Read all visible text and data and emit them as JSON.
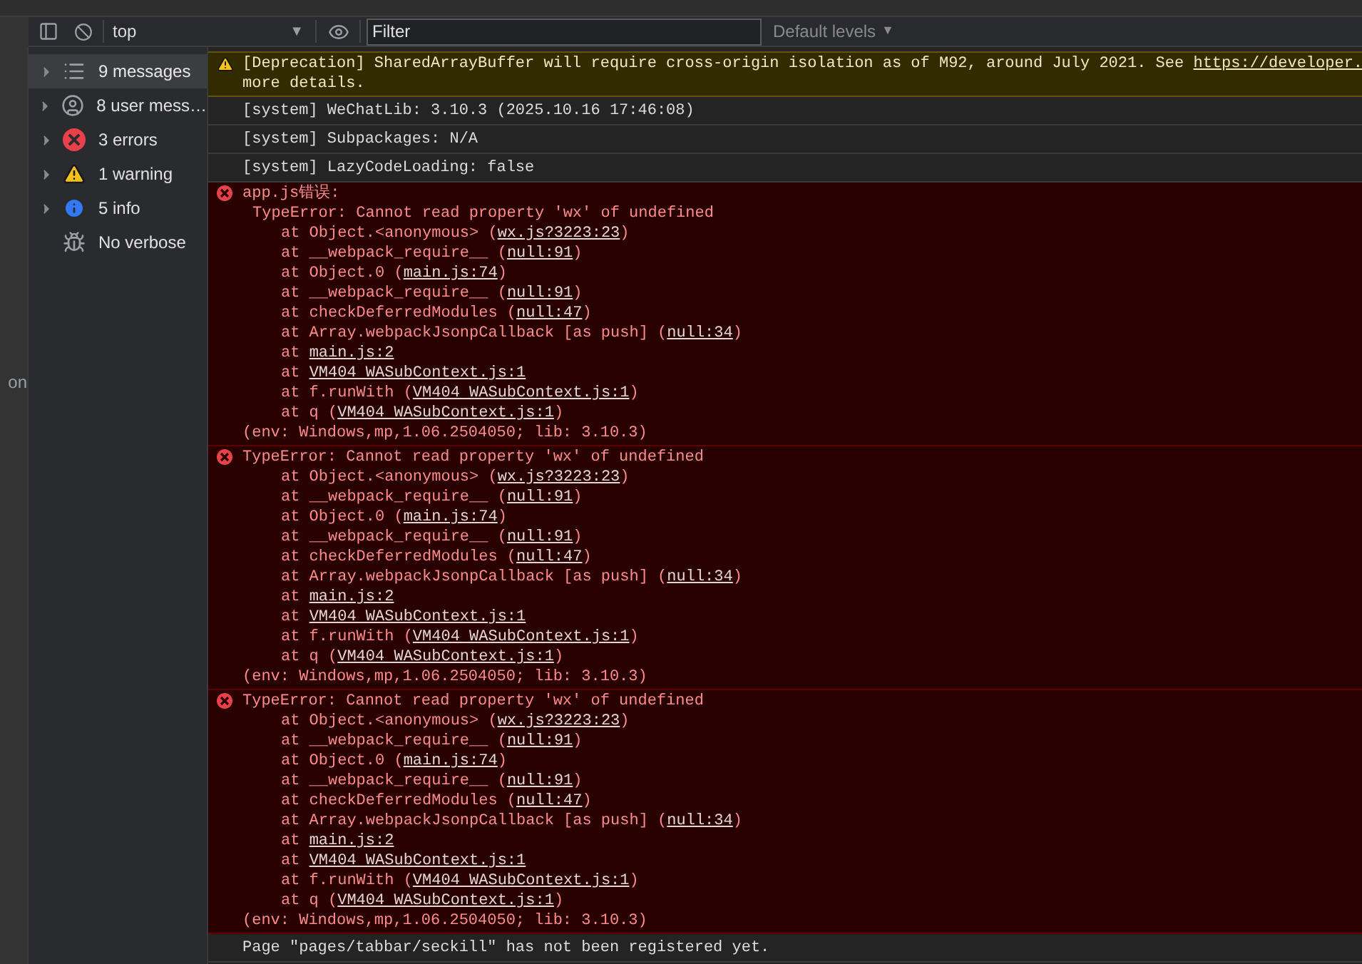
{
  "toolbar": {
    "context": "top",
    "context_caret": "▼",
    "filter": {
      "placeholder": "Filter"
    },
    "levels": "Default levels",
    "levels_caret": "▼"
  },
  "edge_text": "on",
  "sidebar": {
    "items": [
      {
        "kind": "list",
        "label": "9 messages",
        "selected": true,
        "expanded": false
      },
      {
        "kind": "user",
        "label": "8 user mess…",
        "selected": false,
        "expanded": false
      },
      {
        "kind": "error",
        "label": "3 errors",
        "selected": false,
        "expanded": false
      },
      {
        "kind": "warning",
        "label": "1 warning",
        "selected": false,
        "expanded": false
      },
      {
        "kind": "info",
        "label": "5 info",
        "selected": false,
        "expanded": false
      },
      {
        "kind": "verbose",
        "label": "No verbose",
        "selected": false
      }
    ]
  },
  "messages": [
    {
      "kind": "warning",
      "lines": [
        {
          "text": "[Deprecation] SharedArrayBuffer will require cross-origin isolation as of M92, around July 2021. See ",
          "link": "https://developer."
        },
        {
          "text": "more details."
        }
      ]
    },
    {
      "kind": "system",
      "text": "[system] WeChatLib: 3.10.3 (2025.10.16 17:46:08)"
    },
    {
      "kind": "system",
      "text": "[system] Subpackages: N/A"
    },
    {
      "kind": "system",
      "text": "[system] LazyCodeLoading: false"
    },
    {
      "kind": "error",
      "title": "app.js错误:",
      "error": "TypeError: Cannot read property 'wx' of undefined",
      "frames": [
        {
          "pre": "at Object.<anonymous> (",
          "link": "wx.js?3223:23",
          "post": ")"
        },
        {
          "pre": "at __webpack_require__ (",
          "link": "null:91",
          "post": ")"
        },
        {
          "pre": "at Object.0 (",
          "link": "main.js:74",
          "post": ")"
        },
        {
          "pre": "at __webpack_require__ (",
          "link": "null:91",
          "post": ")"
        },
        {
          "pre": "at checkDeferredModules (",
          "link": "null:47",
          "post": ")"
        },
        {
          "pre": "at Array.webpackJsonpCallback [as push] (",
          "link": "null:34",
          "post": ")"
        },
        {
          "pre": "at ",
          "link": "main.js:2"
        },
        {
          "pre": "at ",
          "link": "VM404 WASubContext.js:1"
        },
        {
          "pre": "at f.runWith (",
          "link": "VM404 WASubContext.js:1",
          "post": ")"
        },
        {
          "pre": "at q (",
          "link": "VM404 WASubContext.js:1",
          "post": ")"
        }
      ],
      "env": "(env: Windows,mp,1.06.2504050; lib: 3.10.3)"
    },
    {
      "kind": "error",
      "error": "TypeError: Cannot read property 'wx' of undefined",
      "frames": [
        {
          "pre": "at Object.<anonymous> (",
          "link": "wx.js?3223:23",
          "post": ")"
        },
        {
          "pre": "at __webpack_require__ (",
          "link": "null:91",
          "post": ")"
        },
        {
          "pre": "at Object.0 (",
          "link": "main.js:74",
          "post": ")"
        },
        {
          "pre": "at __webpack_require__ (",
          "link": "null:91",
          "post": ")"
        },
        {
          "pre": "at checkDeferredModules (",
          "link": "null:47",
          "post": ")"
        },
        {
          "pre": "at Array.webpackJsonpCallback [as push] (",
          "link": "null:34",
          "post": ")"
        },
        {
          "pre": "at ",
          "link": "main.js:2"
        },
        {
          "pre": "at ",
          "link": "VM404 WASubContext.js:1"
        },
        {
          "pre": "at f.runWith (",
          "link": "VM404 WASubContext.js:1",
          "post": ")"
        },
        {
          "pre": "at q (",
          "link": "VM404 WASubContext.js:1",
          "post": ")"
        }
      ],
      "env": "(env: Windows,mp,1.06.2504050; lib: 3.10.3)"
    },
    {
      "kind": "error",
      "error": "TypeError: Cannot read property 'wx' of undefined",
      "frames": [
        {
          "pre": "at Object.<anonymous> (",
          "link": "wx.js?3223:23",
          "post": ")"
        },
        {
          "pre": "at __webpack_require__ (",
          "link": "null:91",
          "post": ")"
        },
        {
          "pre": "at Object.0 (",
          "link": "main.js:74",
          "post": ")"
        },
        {
          "pre": "at __webpack_require__ (",
          "link": "null:91",
          "post": ")"
        },
        {
          "pre": "at checkDeferredModules (",
          "link": "null:47",
          "post": ")"
        },
        {
          "pre": "at Array.webpackJsonpCallback [as push] (",
          "link": "null:34",
          "post": ")"
        },
        {
          "pre": "at ",
          "link": "main.js:2"
        },
        {
          "pre": "at ",
          "link": "VM404 WASubContext.js:1"
        },
        {
          "pre": "at f.runWith (",
          "link": "VM404 WASubContext.js:1",
          "post": ")"
        },
        {
          "pre": "at q (",
          "link": "VM404 WASubContext.js:1",
          "post": ")"
        }
      ],
      "env": "(env: Windows,mp,1.06.2504050; lib: 3.10.3)"
    },
    {
      "kind": "system",
      "text": "Page \"pages/tabbar/seckill\" has not been registered yet."
    }
  ]
}
